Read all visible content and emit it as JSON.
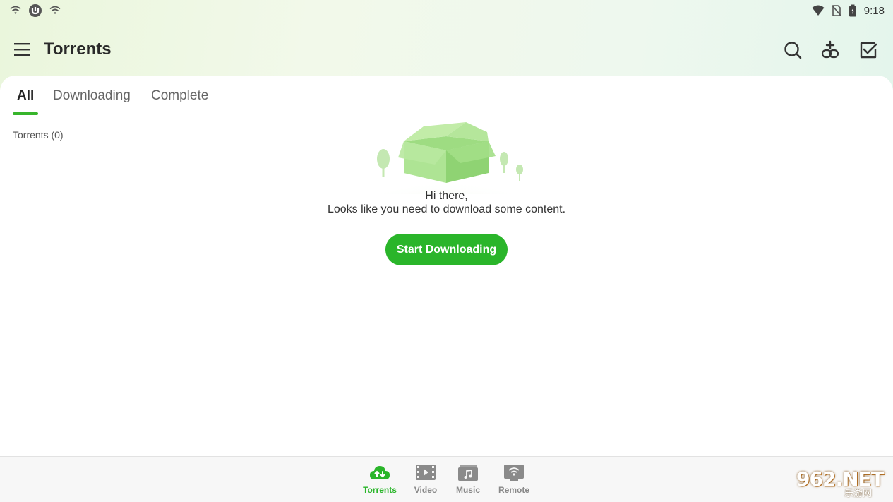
{
  "status_bar": {
    "time": "9:18"
  },
  "app_bar": {
    "title": "Torrents"
  },
  "tabs": [
    {
      "label": "All",
      "active": true
    },
    {
      "label": "Downloading",
      "active": false
    },
    {
      "label": "Complete",
      "active": false
    }
  ],
  "list": {
    "count_label": "Torrents (0)"
  },
  "empty_state": {
    "title": "Hi there,",
    "subtitle": "Looks like you need to download some content.",
    "button_label": "Start Downloading"
  },
  "bottom_nav": [
    {
      "label": "Torrents",
      "icon": "cloud-transfer-icon",
      "active": true
    },
    {
      "label": "Video",
      "icon": "film-icon",
      "active": false
    },
    {
      "label": "Music",
      "icon": "music-folder-icon",
      "active": false
    },
    {
      "label": "Remote",
      "icon": "remote-wifi-icon",
      "active": false
    }
  ],
  "watermark": {
    "text": "962.NET",
    "subtext": "乐游网"
  },
  "colors": {
    "accent": "#2ab52a",
    "header_gradient_start": "#eaf6dc",
    "header_gradient_end": "#e4f5ec",
    "inactive_nav": "#888888"
  }
}
